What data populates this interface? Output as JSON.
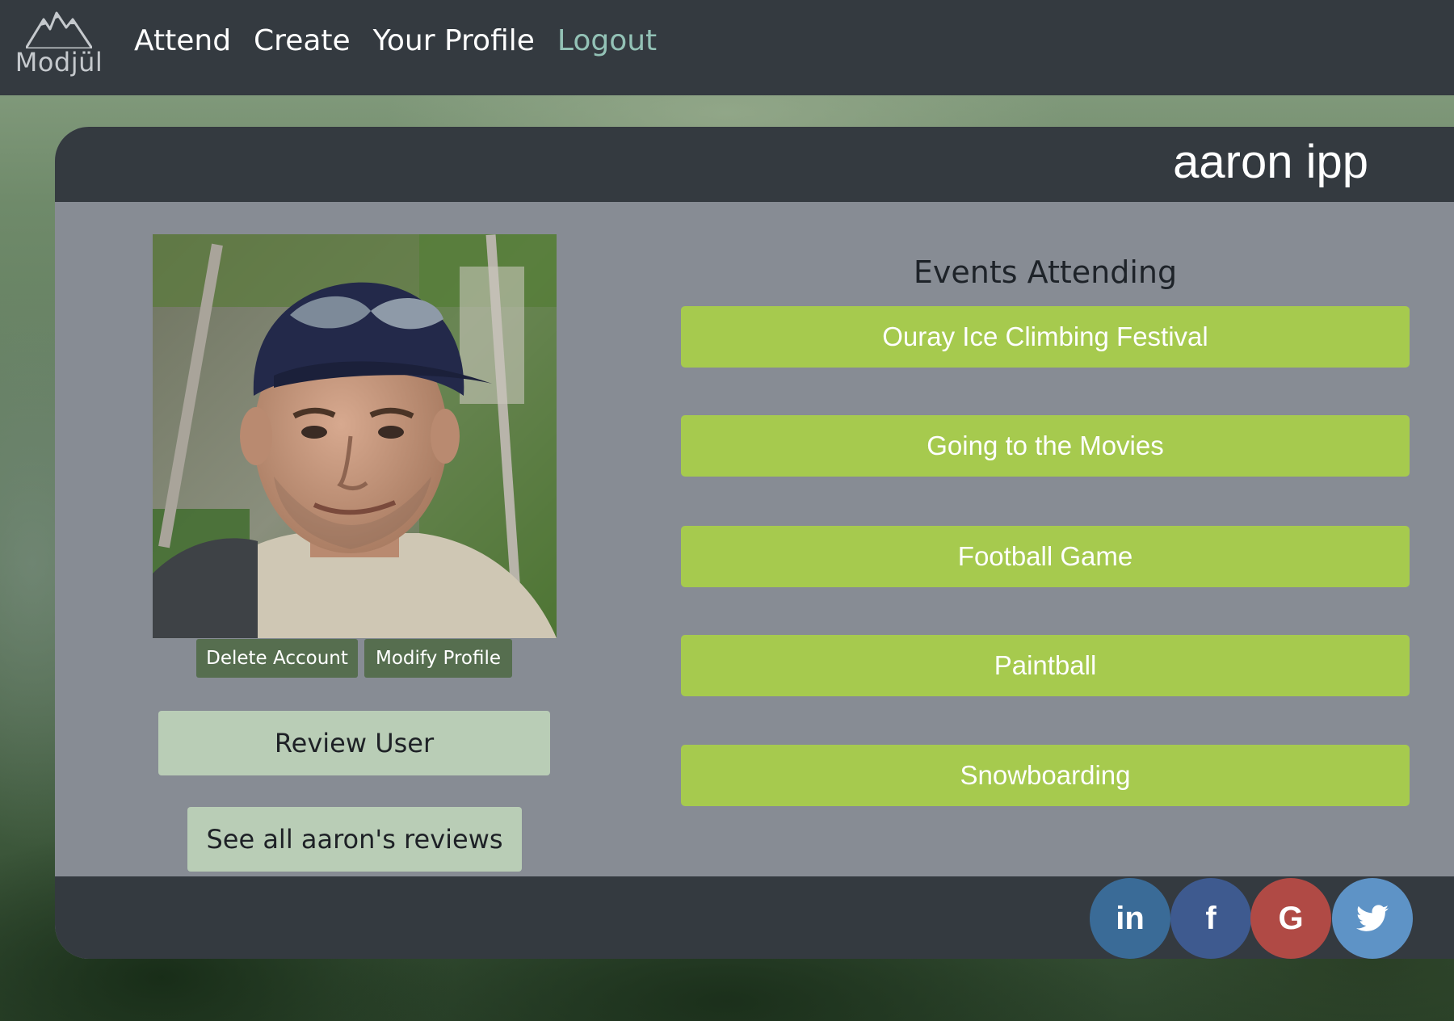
{
  "navbar": {
    "brand": "Modjül",
    "links": [
      "Attend",
      "Create",
      "Your Profile",
      "Logout"
    ]
  },
  "profile": {
    "name": "aaron ipp",
    "delete_label": "Delete Account",
    "modify_label": "Modify Profile",
    "review_label": "Review User",
    "see_reviews_label": "See all aaron's reviews"
  },
  "events": {
    "heading": "Events Attending",
    "items": [
      "Ouray Ice Climbing Festival",
      "Going to the Movies",
      "Football Game",
      "Paintball",
      "Snowboarding"
    ]
  },
  "social": [
    {
      "icon": "linkedin-icon",
      "glyph": "in",
      "color": "#3a6b97"
    },
    {
      "icon": "facebook-icon",
      "glyph": "f",
      "color": "#3e5a8f"
    },
    {
      "icon": "google-icon",
      "glyph": "G",
      "color": "#b04a45"
    },
    {
      "icon": "twitter-icon",
      "glyph": "🐦",
      "color": "#5e93c6"
    }
  ]
}
